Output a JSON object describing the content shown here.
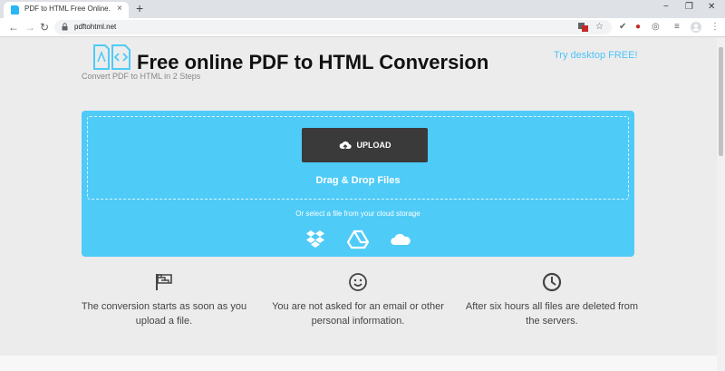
{
  "browser": {
    "tab_title": "PDF to HTML Free Online.",
    "tab_close": "×",
    "new_tab": "+",
    "url": "pdftohtml.net",
    "nav": {
      "back": "←",
      "forward": "→",
      "reload": "↻"
    },
    "window_controls": {
      "minimize": "−",
      "restore": "❐",
      "close": "✕"
    },
    "icons": [
      "lock-icon",
      "translate-icon",
      "star-icon",
      "extension-icon",
      "profile-icon",
      "menu-icon"
    ]
  },
  "header": {
    "title": "Free online PDF to HTML Conversion",
    "subtitle": "Convert PDF to HTML in 2 Steps",
    "try_link": "Try desktop FREE!"
  },
  "upload": {
    "button_label": "UPLOAD",
    "drag_text": "Drag & Drop Files",
    "cloud_text": "Or select a file from your cloud storage",
    "cloud_services": [
      "dropbox-icon",
      "google-drive-icon",
      "onedrive-icon"
    ]
  },
  "features": [
    {
      "icon": "flag-icon",
      "text": "The conversion starts as soon as you upload a file."
    },
    {
      "icon": "smiley-icon",
      "text": "You are not asked for an email or other personal information."
    },
    {
      "icon": "clock-icon",
      "text": "After six hours all files are deleted from the servers."
    }
  ],
  "colors": {
    "accent": "#4fcbf7",
    "upload_button": "#3a3a3a",
    "link": "#4fc3f7",
    "page_background": "#ececec"
  }
}
